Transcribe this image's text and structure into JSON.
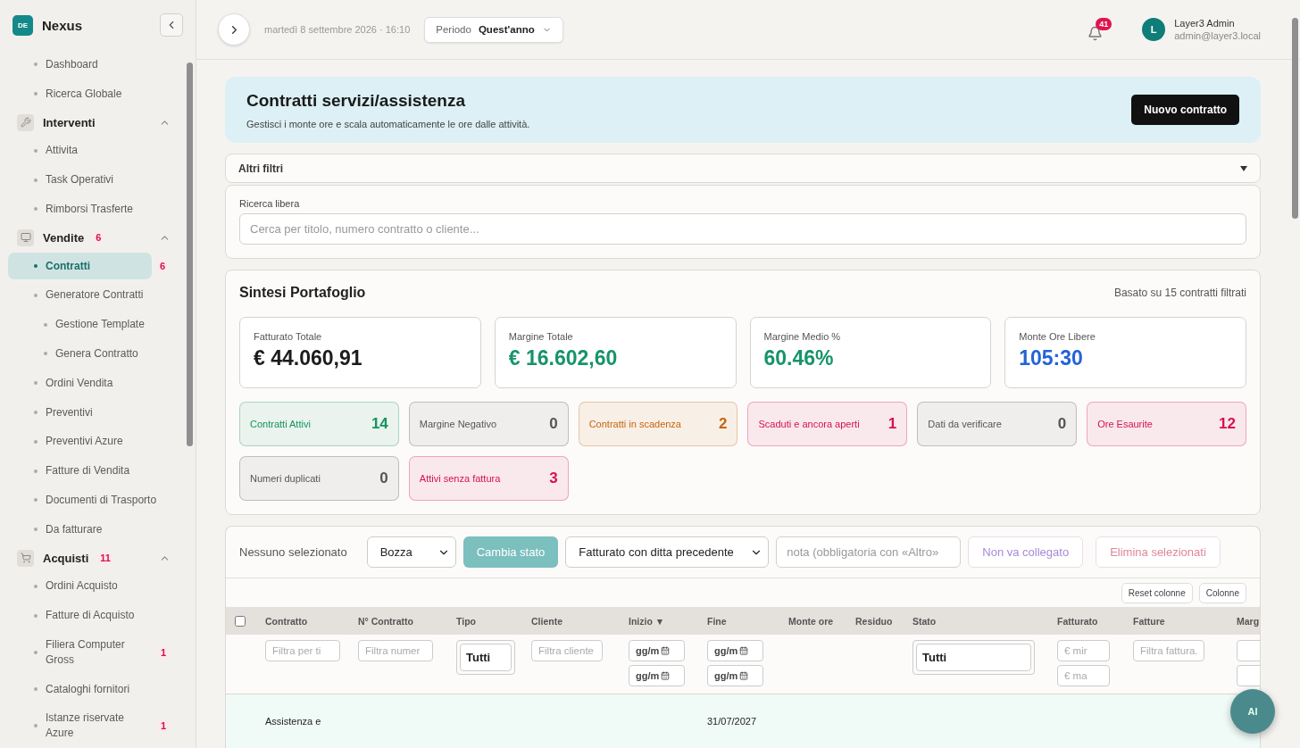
{
  "sidebar": {
    "brand": {
      "initials": "DE",
      "name": "Nexus"
    },
    "items": [
      {
        "kind": "link",
        "label": "Dashboard",
        "selected": false
      },
      {
        "kind": "link",
        "label": "Ricerca Globale",
        "selected": false
      },
      {
        "kind": "group",
        "label": "Interventi",
        "expanded": true,
        "children": [
          {
            "label": "Attivita",
            "selected": false
          },
          {
            "label": "Task Operativi",
            "selected": false
          },
          {
            "label": "Rimborsi Trasferte",
            "selected": false
          }
        ]
      },
      {
        "kind": "group",
        "label": "Vendite",
        "badge": "6",
        "expanded": true,
        "children": [
          {
            "label": "Contratti",
            "selected": true,
            "badge": "6"
          },
          {
            "label": "Generatore Contratti",
            "selected": false,
            "children": [
              {
                "label": "Gestione Template",
                "selected": false
              },
              {
                "label": "Genera Contratto",
                "selected": false
              }
            ]
          },
          {
            "label": "Ordini Vendita",
            "selected": false
          },
          {
            "label": "Preventivi",
            "selected": false
          },
          {
            "label": "Preventivi Azure",
            "selected": false
          },
          {
            "label": "Fatture di Vendita",
            "selected": false
          },
          {
            "label": "Documenti di Trasporto",
            "selected": false
          },
          {
            "label": "Da fatturare",
            "selected": false
          }
        ]
      },
      {
        "kind": "group",
        "label": "Acquisti",
        "badge": "11",
        "expanded": true,
        "children": [
          {
            "label": "Ordini Acquisto",
            "selected": false
          },
          {
            "label": "Fatture di Acquisto",
            "selected": false
          },
          {
            "label": "Filiera Computer Gross",
            "selected": false,
            "badge": "1"
          },
          {
            "label": "Cataloghi fornitori",
            "selected": false
          },
          {
            "label": "Istanze riservate Azure",
            "selected": false,
            "badge": "1"
          }
        ]
      }
    ]
  },
  "header": {
    "datetime": "martedì 8 settembre 2026 · 16:10",
    "period": {
      "label": "Periodo",
      "value": "Quest'anno"
    },
    "notifications": "41",
    "user": {
      "initial": "L",
      "name": "Layer3 Admin",
      "email": "admin@layer3.local"
    }
  },
  "hero": {
    "title": "Contratti servizi/assistenza",
    "subtitle": "Gestisci i monte ore e scala automaticamente le ore dalle attività.",
    "button": "Nuovo contratto"
  },
  "filters": {
    "label": "Altri filtri",
    "expanded": false
  },
  "search": {
    "label": "Ricerca libera",
    "placeholder": "Cerca per titolo, numero contratto o cliente..."
  },
  "summary": {
    "title": "Sintesi Portafoglio",
    "note": "Basato su 15 contratti filtrati",
    "kpis": [
      {
        "label": "Fatturato Totale",
        "value": "€ 44.060,91",
        "color": "#1c1c1c"
      },
      {
        "label": "Margine Totale",
        "value": "€ 16.602,60",
        "color": "#16946a"
      },
      {
        "label": "Margine Medio %",
        "value": "60.46%",
        "color": "#16946a"
      },
      {
        "label": "Monte Ore Libere",
        "value": "105:30",
        "color": "#2463d6"
      }
    ],
    "flags": [
      {
        "label": "Contratti Attivi",
        "count": "14",
        "color": "#15935f"
      },
      {
        "label": "Margine Negativo",
        "count": "0",
        "color": "#555555"
      },
      {
        "label": "Contratti in scadenza",
        "count": "2",
        "color": "#c7650c"
      },
      {
        "label": "Scaduti e ancora aperti",
        "count": "1",
        "color": "#d5124f"
      },
      {
        "label": "Dati da verificare",
        "count": "0",
        "color": "#555555"
      },
      {
        "label": "Ore Esaurite",
        "count": "12",
        "color": "#d5124f"
      },
      {
        "label": "Numeri duplicati",
        "count": "0",
        "color": "#555555"
      },
      {
        "label": "Attivi senza fattura",
        "count": "3",
        "color": "#d5124f"
      }
    ]
  },
  "toolbar": {
    "selection": "Nessuno selezionato",
    "status_select": "Bozza",
    "change_button": "Cambia stato",
    "reason_select": "Fatturato con ditta precedente",
    "note_placeholder": "nota (obbligatoria con «Altro»",
    "unlink_button": "Non va collegato",
    "delete_button": "Elimina selezionati",
    "reset_button": "Reset colonne",
    "columns_button": "Colonne"
  },
  "table": {
    "select_all": false,
    "columns": [
      {
        "label": "Contratto",
        "kind": "text",
        "placeholder": "Filtra per ti"
      },
      {
        "label": "N° Contratto",
        "kind": "text",
        "placeholder": "Filtra numer"
      },
      {
        "label": "Tipo",
        "kind": "select",
        "value": "Tutti"
      },
      {
        "label": "Cliente",
        "kind": "text",
        "placeholder": "Filtra cliente"
      },
      {
        "label": "Inizio ▼",
        "kind": "date",
        "placeholders": [
          "gg/m",
          "gg/m"
        ]
      },
      {
        "label": "Fine",
        "kind": "date",
        "placeholders": [
          "gg/m",
          "gg/m"
        ]
      },
      {
        "label": "Monte ore",
        "kind": "plain"
      },
      {
        "label": "Residuo",
        "kind": "plain"
      },
      {
        "label": "Stato",
        "kind": "select",
        "value": "Tutti"
      },
      {
        "label": "Fatturato",
        "kind": "range",
        "placeholders": [
          "€ mir",
          "€ ma"
        ]
      },
      {
        "label": "Fatture",
        "kind": "text",
        "placeholder": "Filtra fattura."
      },
      {
        "label": "Marg",
        "kind": "range"
      }
    ],
    "rows": [
      {
        "contratto": "Assistenza e",
        "fine": "31/07/2027"
      }
    ]
  },
  "assistant": {
    "label": "AI"
  }
}
